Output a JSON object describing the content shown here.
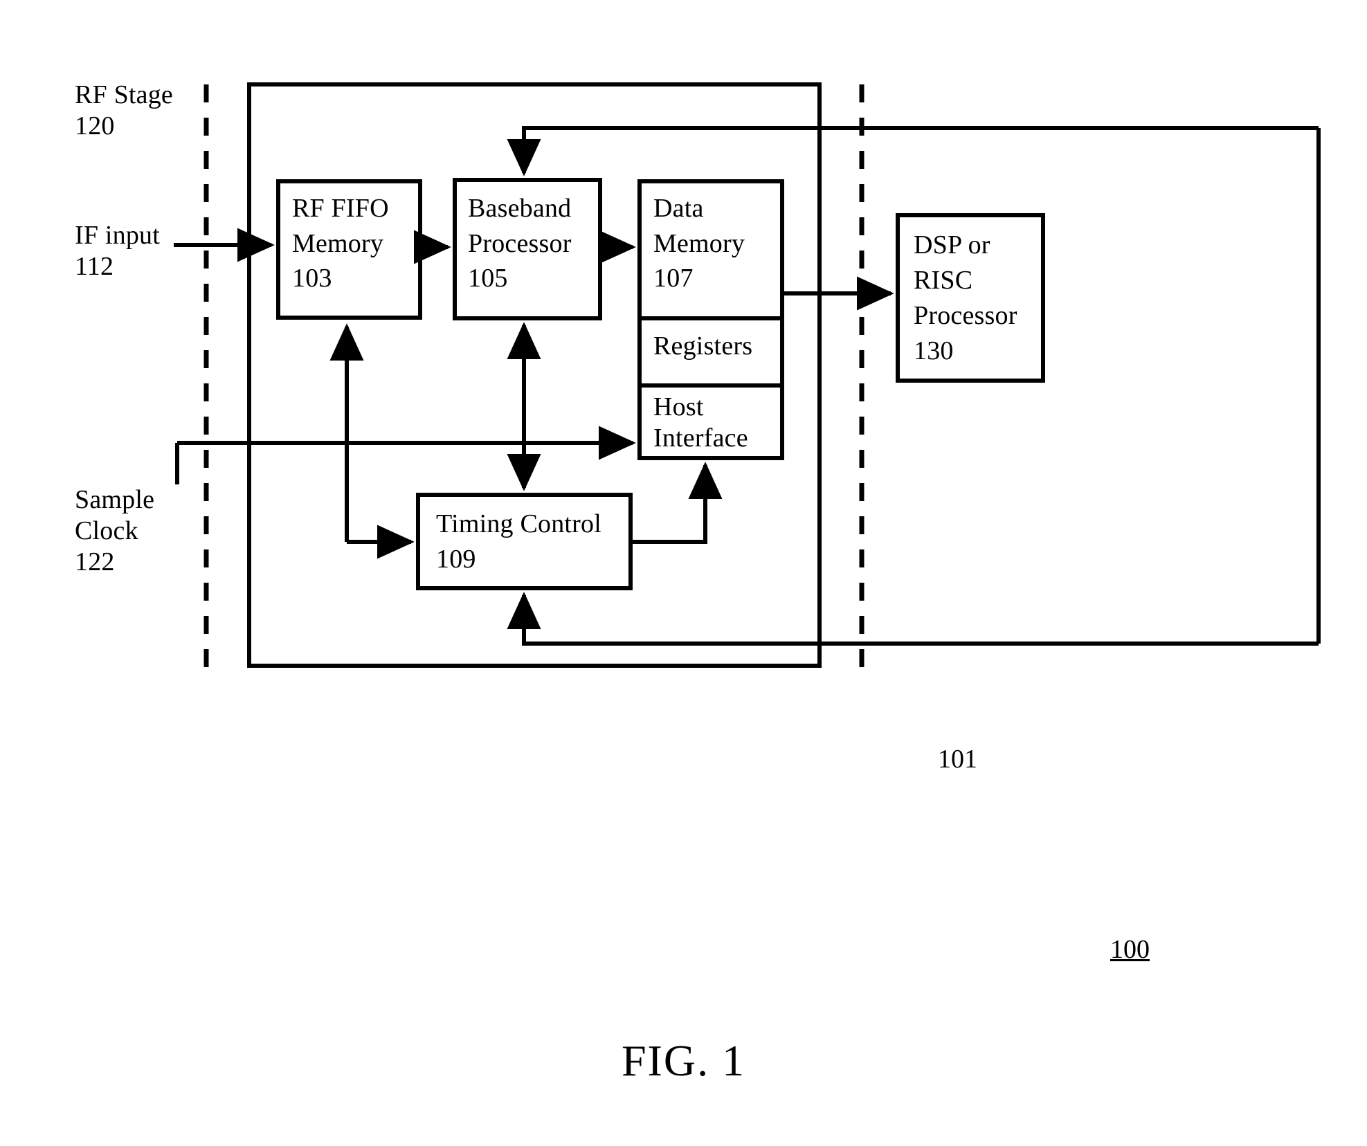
{
  "figure": {
    "caption": "FIG. 1",
    "system_ref": "100",
    "chip_ref": "101"
  },
  "side_labels": [
    {
      "name": "rf-stage",
      "text": "RF Stage\n120"
    },
    {
      "name": "if-input",
      "text": "IF input\n112"
    },
    {
      "name": "sample-clock",
      "text": "Sample\nClock\n122"
    }
  ],
  "blocks": [
    {
      "name": "rf-fifo-memory",
      "title": "RF FIFO",
      "line2": "Memory",
      "ref": "103"
    },
    {
      "name": "baseband-processor",
      "title": "Baseband",
      "line2": "Processor",
      "ref": "105"
    },
    {
      "name": "data-memory",
      "title": "Data",
      "line2": "Memory",
      "ref": "107"
    },
    {
      "name": "registers",
      "title": "Registers",
      "line2": "",
      "ref": ""
    },
    {
      "name": "host-interface",
      "title": "Host",
      "line2": "Interface",
      "ref": ""
    },
    {
      "name": "timing-control",
      "title": "Timing Control",
      "line2": "109",
      "ref": ""
    },
    {
      "name": "dsp-risc-processor",
      "title": "DSP or",
      "line2": "RISC",
      "line3": "Processor",
      "ref": "130"
    }
  ],
  "block_text": {
    "rf_fifo_l1": "RF FIFO",
    "rf_fifo_l2": "Memory",
    "rf_fifo_l3": "103",
    "baseband_l1": "Baseband",
    "baseband_l2": "Processor",
    "baseband_l3": "105",
    "data_memory_l1": "Data",
    "data_memory_l2": "Memory",
    "data_memory_l3": "107",
    "registers_l1": "Registers",
    "host_interface_l1": "Host",
    "host_interface_l2": "Interface",
    "timing_l1": "Timing Control",
    "timing_l2": "109",
    "dsp_l1": "DSP or",
    "dsp_l2": "RISC",
    "dsp_l3": "Processor",
    "dsp_l4": "130"
  },
  "colors": {
    "stroke": "#000000",
    "background": "#ffffff"
  }
}
